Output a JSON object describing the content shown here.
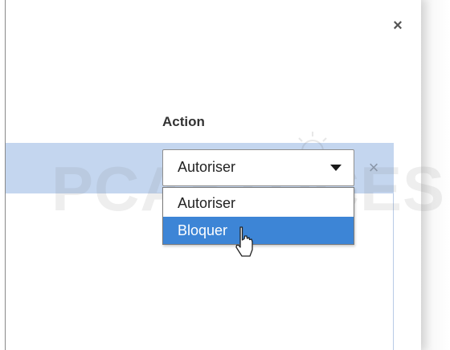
{
  "dialog": {
    "close_glyph": "×"
  },
  "table": {
    "action_header": "Action"
  },
  "row": {
    "select_value": "Autoriser",
    "remove_glyph": "×"
  },
  "dropdown": {
    "options": [
      {
        "label": "Autoriser",
        "highlighted": false
      },
      {
        "label": "Bloquer",
        "highlighted": true
      }
    ]
  },
  "watermark": {
    "text": "PCASTUCES"
  },
  "colors": {
    "row_highlight": "#c4d6ef",
    "option_highlight": "#3d85d6"
  }
}
